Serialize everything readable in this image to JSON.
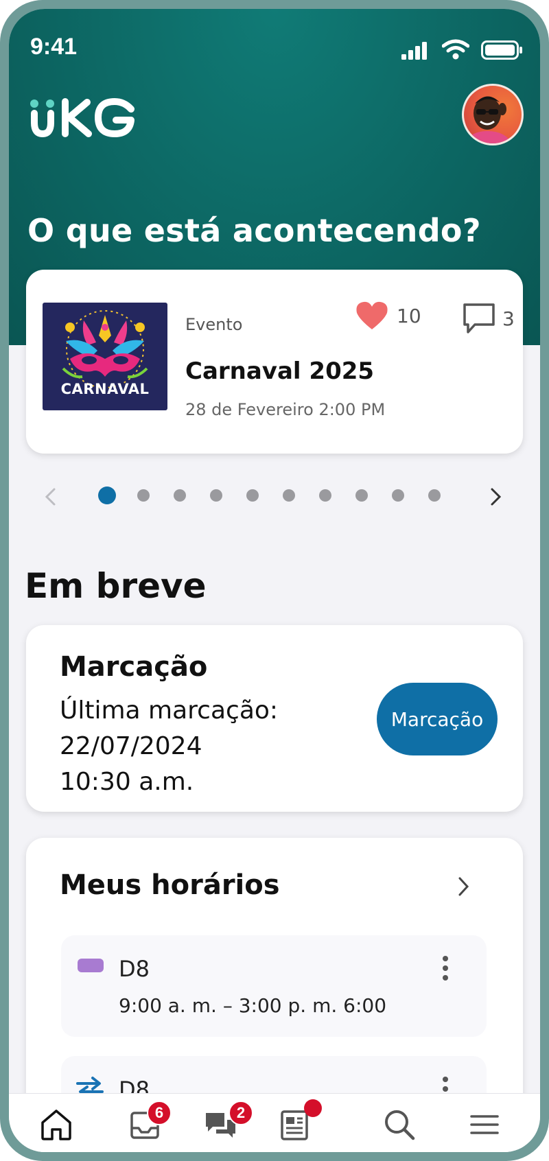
{
  "status_bar": {
    "time": "9:41"
  },
  "header": {
    "logo_text": "UKG",
    "headline": "O que está acontecendo?"
  },
  "event_card": {
    "image_label": "CARNAVAL",
    "type": "Evento",
    "title": "Carnaval 2025",
    "date": "28 de Fevereiro 2:00 PM",
    "likes": "10",
    "comments": "3"
  },
  "carousel": {
    "dot_count": 10,
    "active_index": 0
  },
  "upcoming": {
    "title": "Em breve",
    "punch": {
      "title": "Marcação",
      "last_label": "Última marcação:",
      "last_date": "22/07/2024",
      "last_time": "10:30 a.m.",
      "button_label": "Marcação"
    },
    "schedule": {
      "title": "Meus horários",
      "shifts": [
        {
          "code": "D8",
          "time": "9:00 a. m. – 3:00 p. m. 6:00",
          "tag_color": "#a87bd1"
        },
        {
          "code": "D8"
        }
      ]
    }
  },
  "bottom_nav": {
    "inbox_badge": "6",
    "chat_badge": "2"
  },
  "colors": {
    "brand_teal": "#0d6a66",
    "accent_blue": "#0f6fa6",
    "badge_red": "#d40f2a",
    "heart": "#ef6a6a"
  }
}
